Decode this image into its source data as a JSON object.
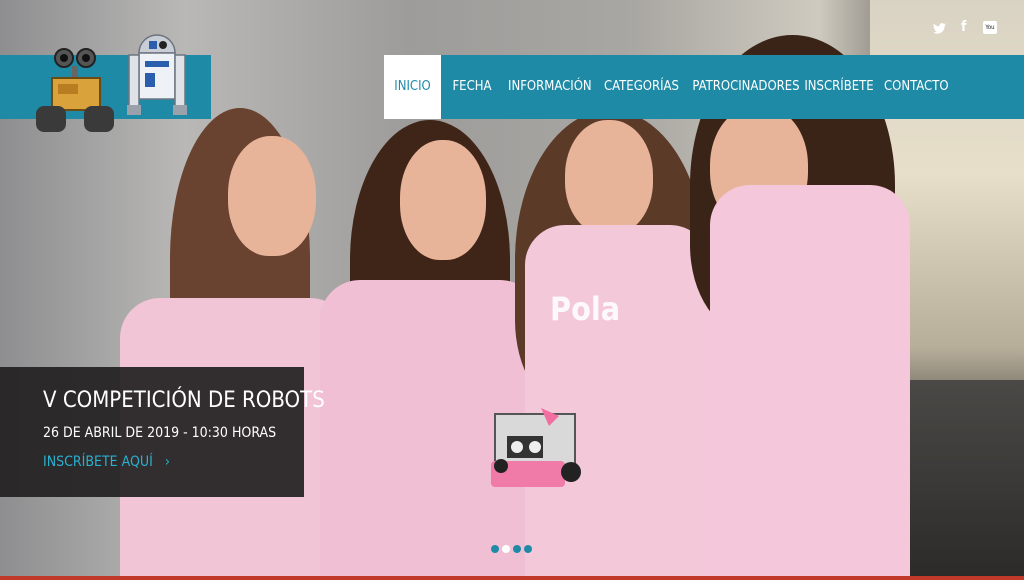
{
  "nav": {
    "items": [
      {
        "label": "INICIO"
      },
      {
        "label": "FECHA"
      },
      {
        "label": "INFORMACIÓN"
      },
      {
        "label": "CATEGORÍAS"
      },
      {
        "label": "PATROCINADORES"
      },
      {
        "label": "INSCRÍBETE"
      },
      {
        "label": "CONTACTO"
      }
    ],
    "active_index": 0
  },
  "social": {
    "icons": [
      "twitter-icon",
      "facebook-icon",
      "youtube-icon"
    ],
    "facebook_glyph": "f",
    "youtube_glyph": "You"
  },
  "hero": {
    "title": "V COMPETICIÓN DE ROBOTS",
    "date": "26 DE ABRIL DE 2019 - 10:30 HORAS",
    "cta": "INSCRÍBETE AQUÍ",
    "cta_arrow": "›",
    "shirt_text": "Pola"
  },
  "carousel": {
    "slide_count": 4,
    "active_slide": 2
  },
  "colors": {
    "accent": "#1f8aa6",
    "link": "#2ab0d1",
    "caption_bg": "#22201f"
  }
}
